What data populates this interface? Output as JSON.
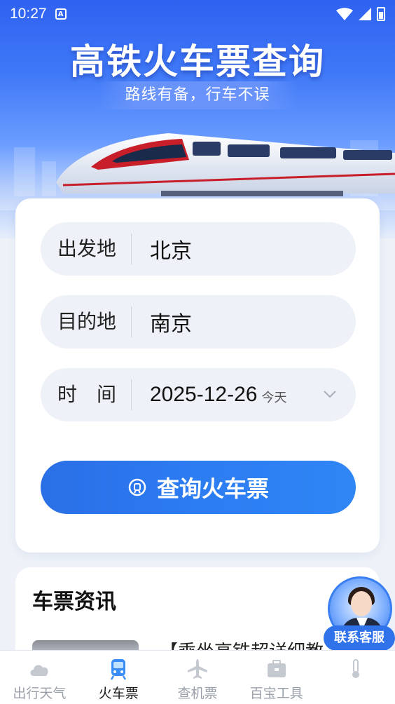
{
  "status_bar": {
    "time": "10:27",
    "notification_icon": "A"
  },
  "hero": {
    "title": "高铁火车票查询",
    "subtitle": "路线有备，行车不误"
  },
  "form": {
    "origin": {
      "label": "出发地",
      "value": "北京"
    },
    "destination": {
      "label": "目的地",
      "value": "南京"
    },
    "date": {
      "label": "时　间",
      "value": "2025-12-26",
      "hint": "今天"
    },
    "search_button": "查询火车票"
  },
  "news": {
    "title": "车票资讯",
    "headline": "【乘坐高铁超详细教"
  },
  "customer_service": {
    "label": "联系客服"
  },
  "tabs": [
    {
      "label": "出行天气",
      "icon": "cloud-icon",
      "active": false
    },
    {
      "label": "火车票",
      "icon": "train-icon",
      "active": true
    },
    {
      "label": "查机票",
      "icon": "airplane-icon",
      "active": false
    },
    {
      "label": "百宝工具",
      "icon": "toolbox-icon",
      "active": false
    },
    {
      "label": "",
      "icon": "thermometer-icon",
      "active": false
    }
  ],
  "colors": {
    "primary": "#2c7cf2",
    "hero_top": "#2f62f0",
    "background": "#eef2f8"
  }
}
